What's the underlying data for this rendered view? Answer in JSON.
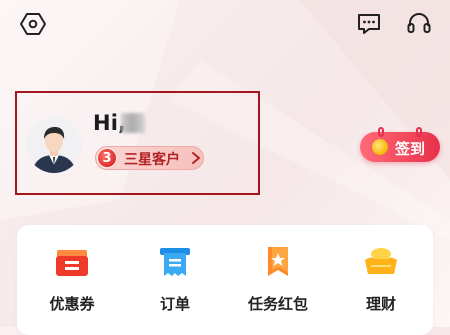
{
  "header": {
    "settings_icon": "hexagon-settings-icon",
    "message_icon": "message-icon",
    "service_icon": "headset-icon"
  },
  "profile": {
    "greeting": "Hi,",
    "level_number": "3",
    "level_label": "三星客户"
  },
  "signin": {
    "label": "签到"
  },
  "menu": [
    {
      "label": "优惠券",
      "icon": "coupon-icon"
    },
    {
      "label": "订单",
      "icon": "order-receipt-icon"
    },
    {
      "label": "任务红包",
      "icon": "task-redpacket-icon"
    },
    {
      "label": "理财",
      "icon": "gold-ingot-icon"
    }
  ],
  "colors": {
    "highlight_border": "#a3161b",
    "accent": "#e7304a",
    "level_text": "#b32224"
  }
}
